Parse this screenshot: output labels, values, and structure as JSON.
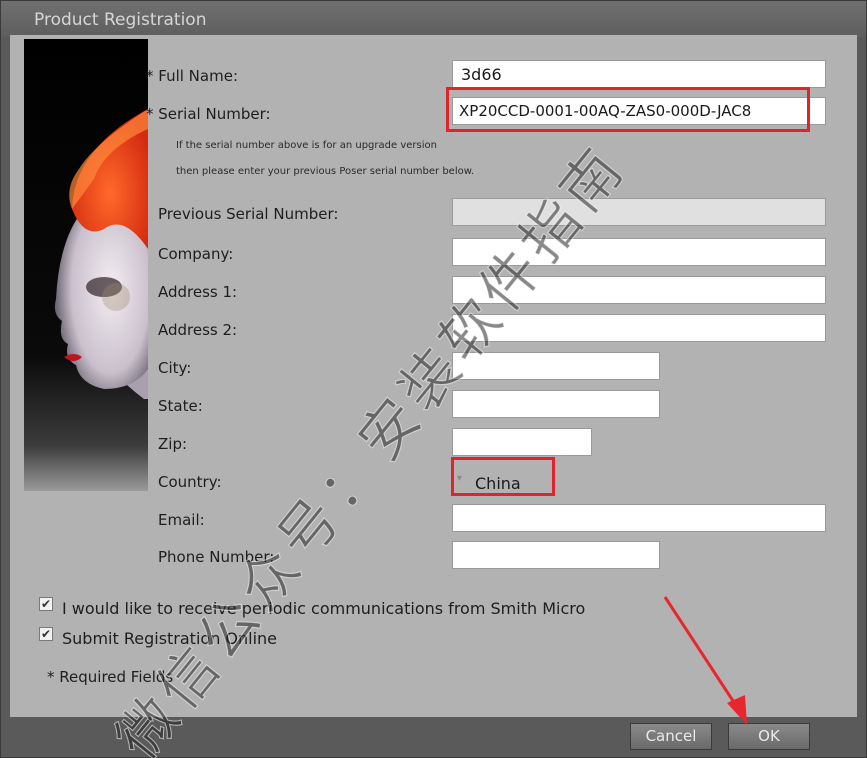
{
  "window": {
    "title": "Product Registration"
  },
  "form": {
    "full_name": {
      "label": "* Full Name:",
      "value": "3d66"
    },
    "serial": {
      "label": "* Serial Number:",
      "value": "XP20CCD-0001-00AQ-ZAS0-000D-JAC8"
    },
    "upgrade_note_1": "If the serial number above is for an upgrade version",
    "upgrade_note_2": "then please enter your previous Poser serial number below.",
    "previous_serial": {
      "label": "Previous Serial Number:",
      "value": ""
    },
    "company": {
      "label": "Company:",
      "value": ""
    },
    "address1": {
      "label": "Address 1:",
      "value": ""
    },
    "address2": {
      "label": "Address 2:",
      "value": ""
    },
    "city": {
      "label": "City:",
      "value": ""
    },
    "state": {
      "label": "State:",
      "value": ""
    },
    "zip": {
      "label": "Zip:",
      "value": ""
    },
    "country": {
      "label": "Country:",
      "value": "China"
    },
    "email": {
      "label": "Email:",
      "value": ""
    },
    "phone": {
      "label": "Phone Number:",
      "value": ""
    }
  },
  "options": {
    "communications": {
      "label": "I would like to receive periodic communications from Smith Micro",
      "checked": true
    },
    "submit_online": {
      "label": "Submit Registration Online",
      "checked": true
    }
  },
  "required_note": "* Required Fields",
  "buttons": {
    "cancel": "Cancel",
    "ok": "OK"
  },
  "watermark": {
    "text": "微信公众号：安装软件指南"
  },
  "colors": {
    "highlight": "#e0242b",
    "arrow": "#e8262d",
    "dialog_bg": "#b2b2b2"
  }
}
